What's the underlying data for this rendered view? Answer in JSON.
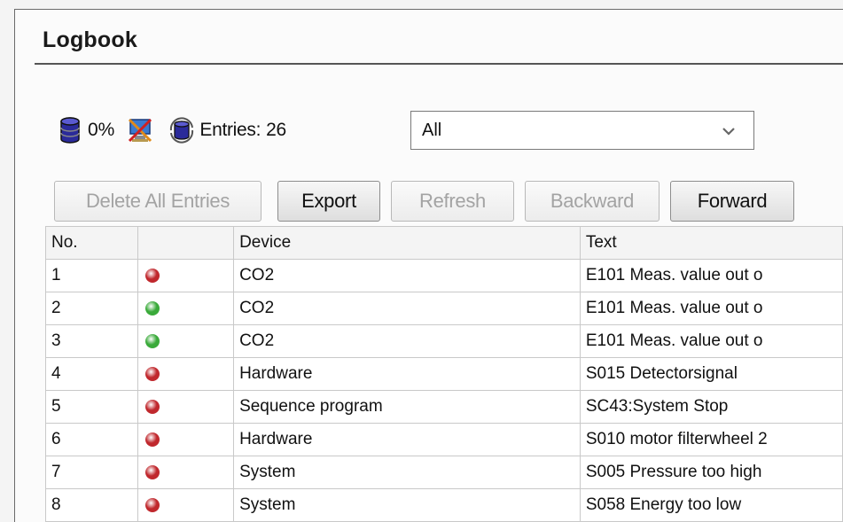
{
  "window": {
    "title": "Logbook"
  },
  "toolbar": {
    "fill_percent": "0%",
    "entries_label": "Entries:",
    "entries_count": "26",
    "filter": {
      "selected": "All"
    }
  },
  "buttons": {
    "delete_all": "Delete All Entries",
    "export": "Export",
    "refresh": "Refresh",
    "backward": "Backward",
    "forward": "Forward"
  },
  "table": {
    "columns": [
      "No.",
      "",
      "Device",
      "Text"
    ],
    "rows": [
      {
        "no": "1",
        "status": "red",
        "device": "CO2",
        "text": "E101 Meas. value out o"
      },
      {
        "no": "2",
        "status": "green",
        "device": "CO2",
        "text": "E101 Meas. value out o"
      },
      {
        "no": "3",
        "status": "green",
        "device": "CO2",
        "text": "E101 Meas. value out o"
      },
      {
        "no": "4",
        "status": "red",
        "device": "Hardware",
        "text": "S015 Detectorsignal"
      },
      {
        "no": "5",
        "status": "red",
        "device": "Sequence program",
        "text": "SC43:System Stop"
      },
      {
        "no": "6",
        "status": "red",
        "device": "Hardware",
        "text": "S010 motor filterwheel 2"
      },
      {
        "no": "7",
        "status": "red",
        "device": "System",
        "text": "S005 Pressure too high"
      },
      {
        "no": "8",
        "status": "red",
        "device": "System",
        "text": "S058 Energy too low"
      }
    ]
  },
  "colors": {
    "red": "#c0282d",
    "green": "#3aaa3a"
  },
  "icons": [
    "database-icon",
    "monitor-disconnected-icon",
    "database-refresh-icon",
    "chevron-down-icon",
    "status-dot-icon"
  ]
}
